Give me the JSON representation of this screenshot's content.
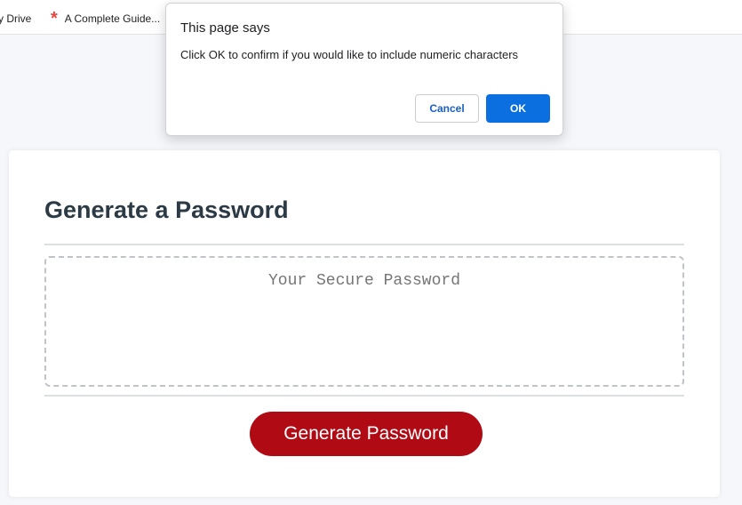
{
  "bookmarks": {
    "items": [
      {
        "label": "y Drive"
      },
      {
        "label": "A Complete Guide...",
        "icon": "asterisk-icon"
      }
    ]
  },
  "dialog": {
    "title": "This page says",
    "message": "Click OK to confirm if you would like to include numeric characters",
    "cancel_label": "Cancel",
    "ok_label": "OK"
  },
  "card": {
    "title": "Generate a Password",
    "password_placeholder": "Your Secure Password",
    "generate_label": "Generate Password"
  },
  "colors": {
    "accent_button": "#b00b14",
    "ok_button": "#0b6fe0",
    "title_text": "#2b3a44"
  }
}
